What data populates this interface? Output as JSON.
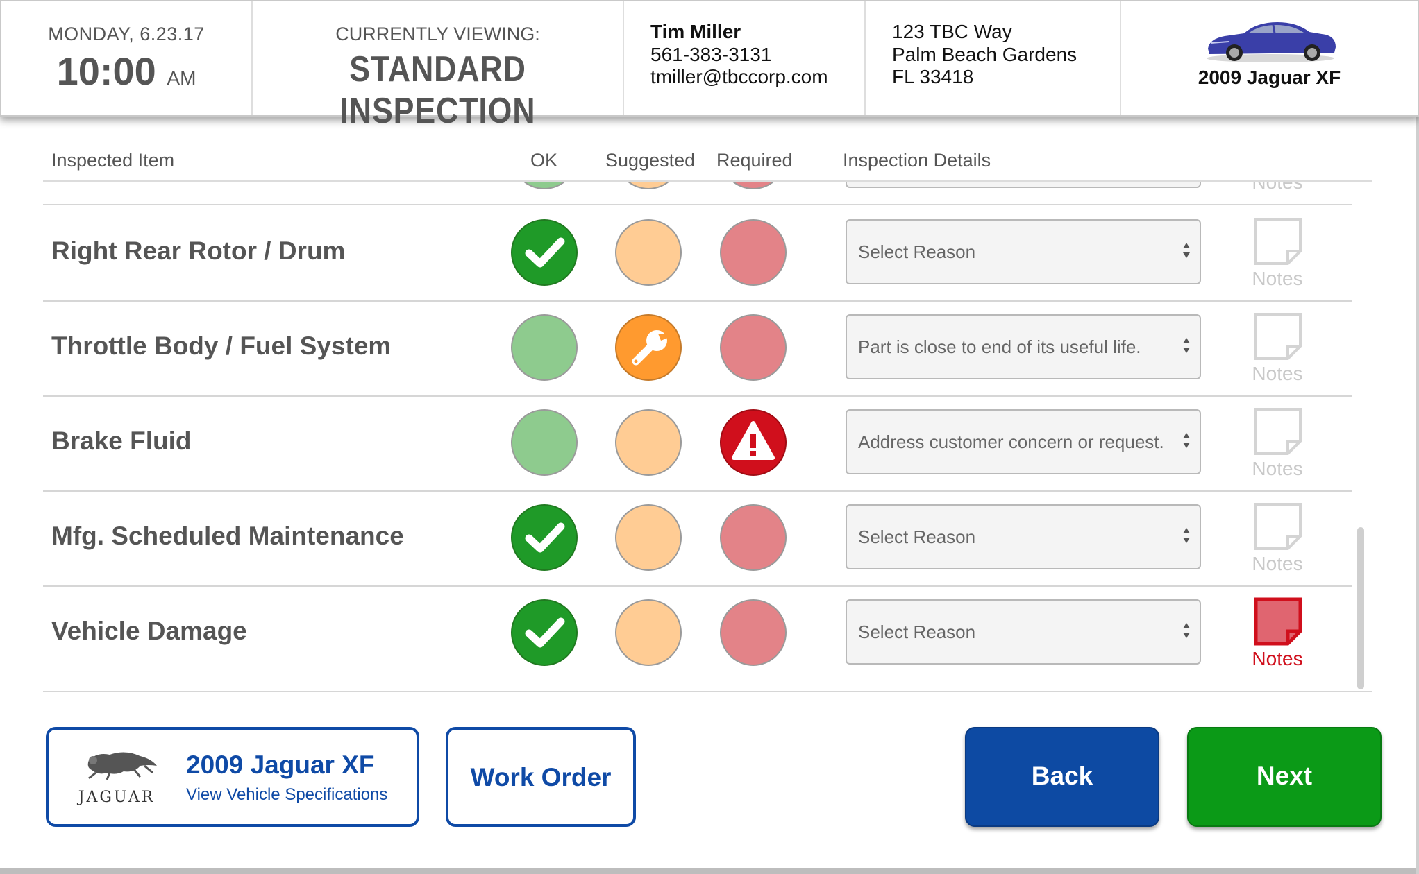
{
  "header": {
    "date": "MONDAY, 6.23.17",
    "time": "10:00",
    "ampm": "AM",
    "viewing_label": "CURRENTLY VIEWING:",
    "viewing_title": "STANDARD INSPECTION",
    "customer": {
      "name": "Tim Miller",
      "phone": "561-383-3131",
      "email": "tmiller@tbccorp.com"
    },
    "address": {
      "line1": "123 TBC Way",
      "line2": "Palm Beach Gardens",
      "line3": "FL 33418"
    },
    "vehicle": "2009 Jaguar XF"
  },
  "columns": {
    "item": "Inspected Item",
    "ok": "OK",
    "suggested": "Suggested",
    "required": "Required",
    "details": "Inspection Details"
  },
  "rows": [
    {
      "name": "",
      "status": "none",
      "reason": "",
      "notes_label": "Notes",
      "notes_active": false
    },
    {
      "name": "Right Rear Rotor / Drum",
      "status": "ok",
      "reason": "Select Reason",
      "notes_label": "Notes",
      "notes_active": false
    },
    {
      "name": "Throttle Body / Fuel System",
      "status": "suggested",
      "reason": "Part is close to end of its useful life.",
      "notes_label": "Notes",
      "notes_active": false
    },
    {
      "name": "Brake Fluid",
      "status": "required",
      "reason": "Address customer concern or request.",
      "notes_label": "Notes",
      "notes_active": false
    },
    {
      "name": "Mfg. Scheduled Maintenance",
      "status": "ok",
      "reason": "Select Reason",
      "notes_label": "Notes",
      "notes_active": false
    },
    {
      "name": "Vehicle Damage",
      "status": "ok",
      "reason": "Select Reason",
      "notes_label": "Notes",
      "notes_active": true
    }
  ],
  "footer": {
    "brand": "JAGUAR",
    "vehicle_name": "2009 Jaguar XF",
    "vehicle_link": "View Vehicle Specifications",
    "work_order": "Work Order",
    "back": "Back",
    "next": "Next"
  },
  "icons": {
    "ok": "checkmark-icon",
    "suggested": "wrench-icon",
    "required": "warning-icon",
    "notes": "note-icon",
    "select": "updown-arrows-icon"
  },
  "colors": {
    "blue": "#0f4aa6",
    "green": "#0b9a17",
    "ok_on": "#1f9a28",
    "suggested_on": "#ff9a2f",
    "required_on": "#d00f1c"
  }
}
